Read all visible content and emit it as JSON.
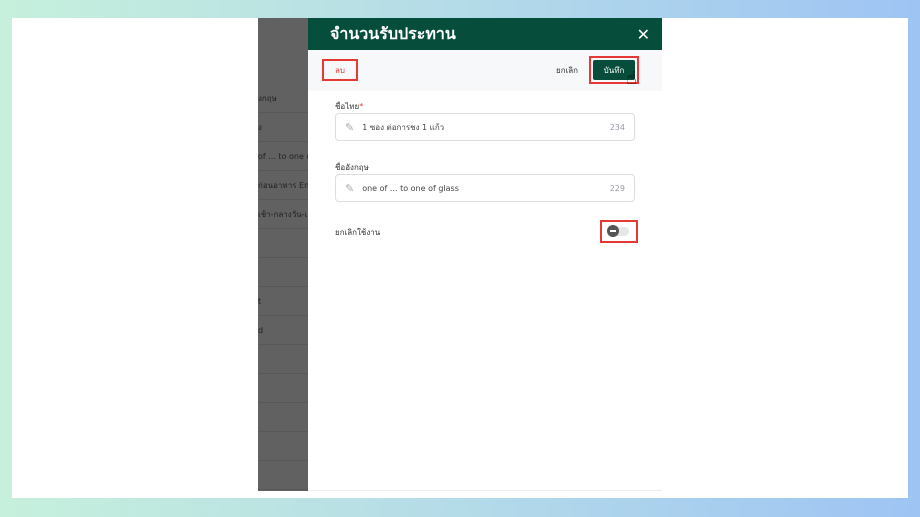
{
  "background_rows": [
    "งกฤษ",
    "ง",
    "of ... to one of",
    "ก่อนอาหาร En",
    "เช้า-กลางวัน-เ",
    "",
    "",
    "t",
    "d",
    "",
    "",
    "",
    "",
    ""
  ],
  "modal": {
    "title": "จำนวนรับประทาน",
    "close_icon": "close-icon",
    "delete_label": "ลบ",
    "cancel_label": "ยกเลิก",
    "save_label": "บันทึก",
    "fields": [
      {
        "label": "ชื่อไทย",
        "required": "*",
        "value": "1 ซอง ต่อการชง 1 แก้ว",
        "count": "234"
      },
      {
        "label": "ชื่ออังกฤษ",
        "value": "one of ... to one of glass",
        "count": "229"
      }
    ],
    "toggle": {
      "label": "ยกเลิกใช้งาน",
      "on": false
    }
  },
  "colors": {
    "header": "#064e3b",
    "highlight": "#e53935"
  }
}
